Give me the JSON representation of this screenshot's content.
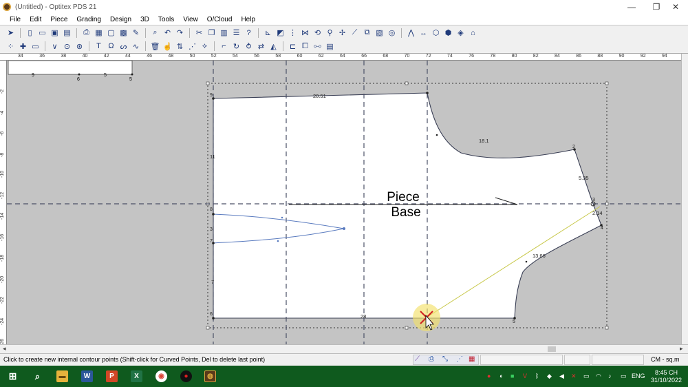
{
  "window": {
    "title": "(Untitled) - Optitex PDS 21",
    "minimize_glyph": "—",
    "restore_glyph": "❐",
    "close_glyph": "✕"
  },
  "menu": [
    "File",
    "Edit",
    "Piece",
    "Grading",
    "Design",
    "3D",
    "Tools",
    "View",
    "O/Cloud",
    "Help"
  ],
  "ruler": {
    "top_labels": [
      "34",
      "36",
      "38",
      "40",
      "42",
      "44",
      "46",
      "48",
      "50",
      "52",
      "54",
      "56",
      "58",
      "60",
      "62",
      "64",
      "66",
      "68",
      "70",
      "72",
      "74",
      "76",
      "78",
      "80",
      "82",
      "84",
      "86",
      "88",
      "90",
      "92",
      "94"
    ],
    "left_labels": [
      "-2",
      "-4",
      "-6",
      "-8",
      "-10",
      "-12",
      "-14",
      "-16",
      "-18",
      "-20",
      "-22",
      "-24",
      "-26"
    ]
  },
  "mini_strip": {
    "labels": [
      "9",
      "6",
      "5",
      "5"
    ]
  },
  "piece": {
    "name_line1": "Piece",
    "name_line2": "Base",
    "measurements": {
      "top_edge": "20.51",
      "armhole_top": "18.1",
      "shoulder": "5.35",
      "short_edge": "2.14",
      "armhole_bottom": "13.66",
      "bottom_edge": "28",
      "left_upper": "11",
      "left_lower": "7"
    },
    "point_labels": {
      "top_left": "9",
      "shoulder_start": "2",
      "corner": "3",
      "lower_corner": "4",
      "bottom_right": "5",
      "bottom_left": "6",
      "dart_top": "8",
      "dart_mid": "3",
      "dart_bottom": "7"
    }
  },
  "status": {
    "hint": "Click to create new internal contour points (Shift-click for Curved Points, Del to delete last point)",
    "units": "CM - sq.m"
  },
  "taskbar": {
    "language": "ENG",
    "time": "8:45 CH",
    "date": "31/10/2022"
  },
  "colors": {
    "taskbar": "#0f5a1e",
    "workarea": "#c4c4c4",
    "piece_fill": "#ffffff",
    "guide_line": "#4a4f66",
    "dart_line": "#5a7bbf",
    "cursor_line": "#c8c84a",
    "cursor_x": "#d02020"
  }
}
